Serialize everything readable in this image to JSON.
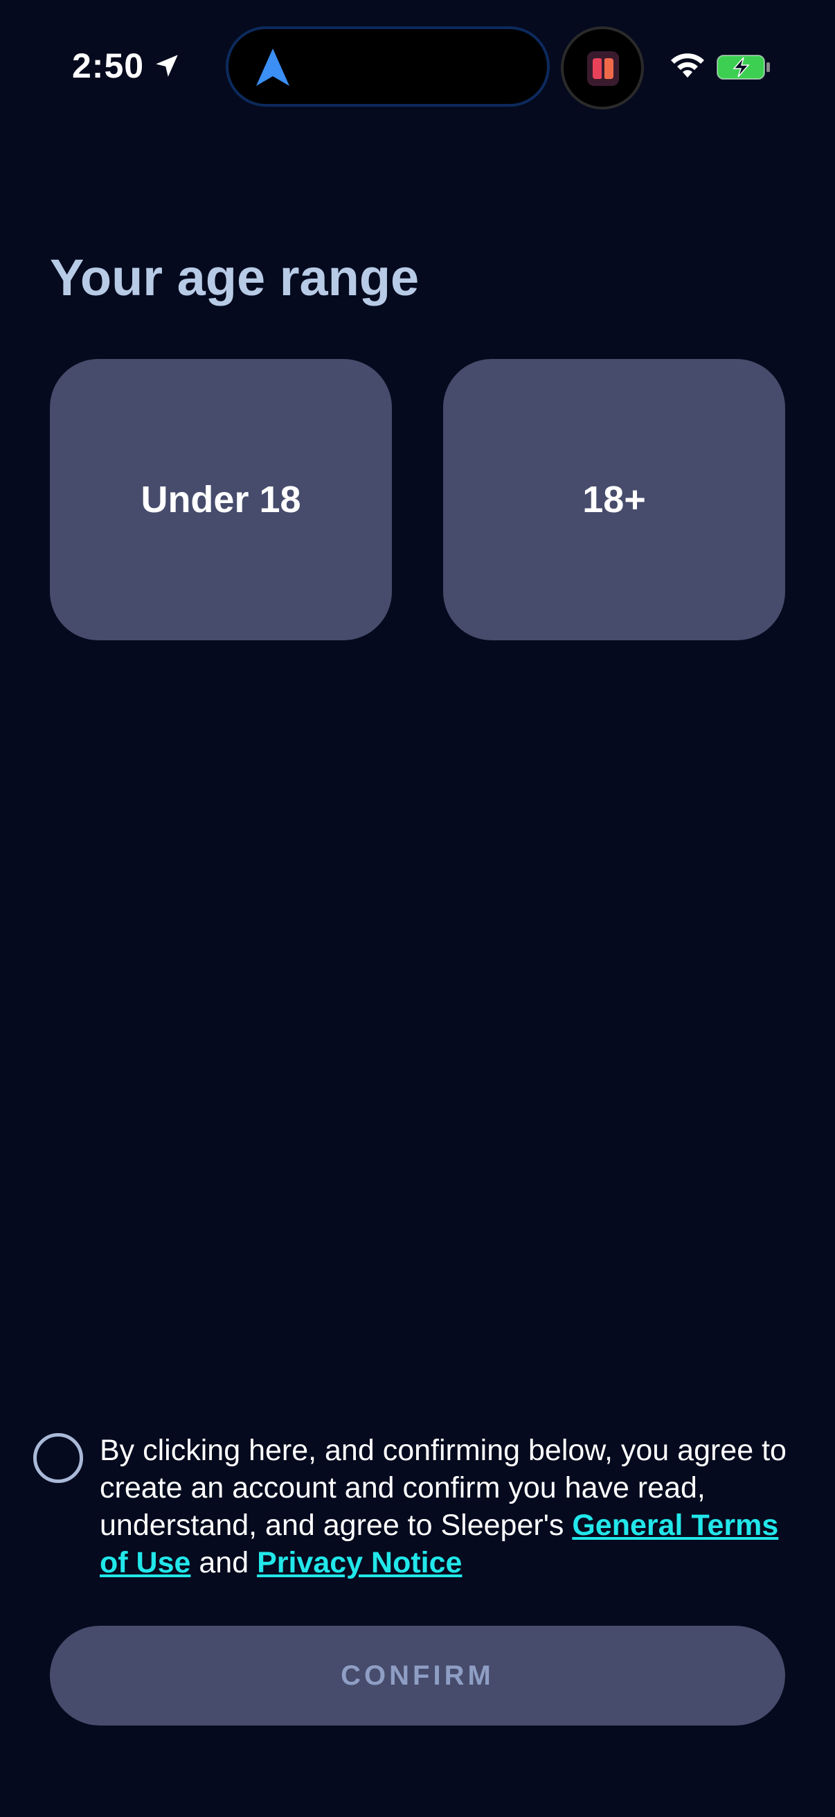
{
  "status_bar": {
    "time": "2:50",
    "icons": [
      "location-arrow-icon",
      "navigation-arrow-icon",
      "app-icon",
      "wifi-icon",
      "battery-charging-icon"
    ]
  },
  "page": {
    "title": "Your age range"
  },
  "options": {
    "under_18": "Under 18",
    "over_18": "18+"
  },
  "consent": {
    "text_before": "By clicking here, and confirming below, you agree to create an account and confirm you have read, understand, and agree to Sleeper's ",
    "terms_link": "General Terms of Use",
    "and": " and ",
    "privacy_link": "Privacy Notice"
  },
  "confirm": {
    "label": "CONFIRM"
  },
  "colors": {
    "background": "#050a1e",
    "card": "#474c6c",
    "title": "#b8cbe6",
    "link": "#22e7ea",
    "button_text": "#8f9ec4"
  }
}
